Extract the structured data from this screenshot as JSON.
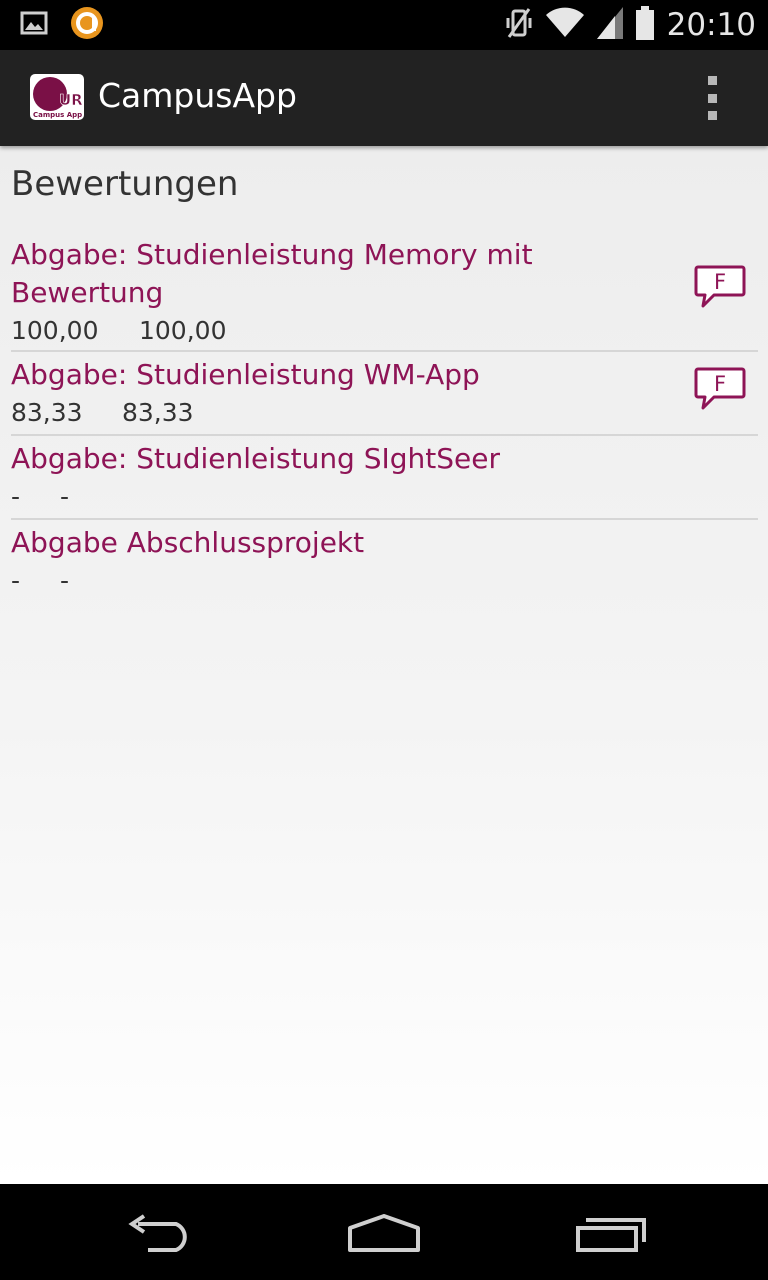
{
  "status_bar": {
    "time": "20:10",
    "left_icons": [
      "picture-icon",
      "notification-app-icon"
    ],
    "right_icons": [
      "vibrate-off-icon",
      "wifi-icon",
      "signal-icon",
      "battery-icon"
    ]
  },
  "action_bar": {
    "title": "CampusApp",
    "logo": {
      "letters": "UR",
      "caption": "Campus App"
    }
  },
  "page": {
    "title": "Bewertungen",
    "items": [
      {
        "title": "Abgabe: Studienleistung Memory mit Bewertung",
        "score1": "100,00",
        "score2": "100,00",
        "has_feedback": true,
        "feedback_letter": "F"
      },
      {
        "title": "Abgabe: Studienleistung WM-App",
        "score1": "83,33",
        "score2": "83,33",
        "has_feedback": true,
        "feedback_letter": "F"
      },
      {
        "title": "Abgabe: Studienleistung SIghtSeer",
        "score1": "-",
        "score2": "-",
        "has_feedback": false
      },
      {
        "title": "Abgabe Abschlussprojekt",
        "score1": "-",
        "score2": "-",
        "has_feedback": false
      }
    ]
  },
  "colors": {
    "accent": "#8e1456",
    "action_bar": "#222222",
    "text": "#333333"
  },
  "nav_bar": {
    "buttons": [
      "back-icon",
      "home-icon",
      "recents-icon"
    ]
  }
}
